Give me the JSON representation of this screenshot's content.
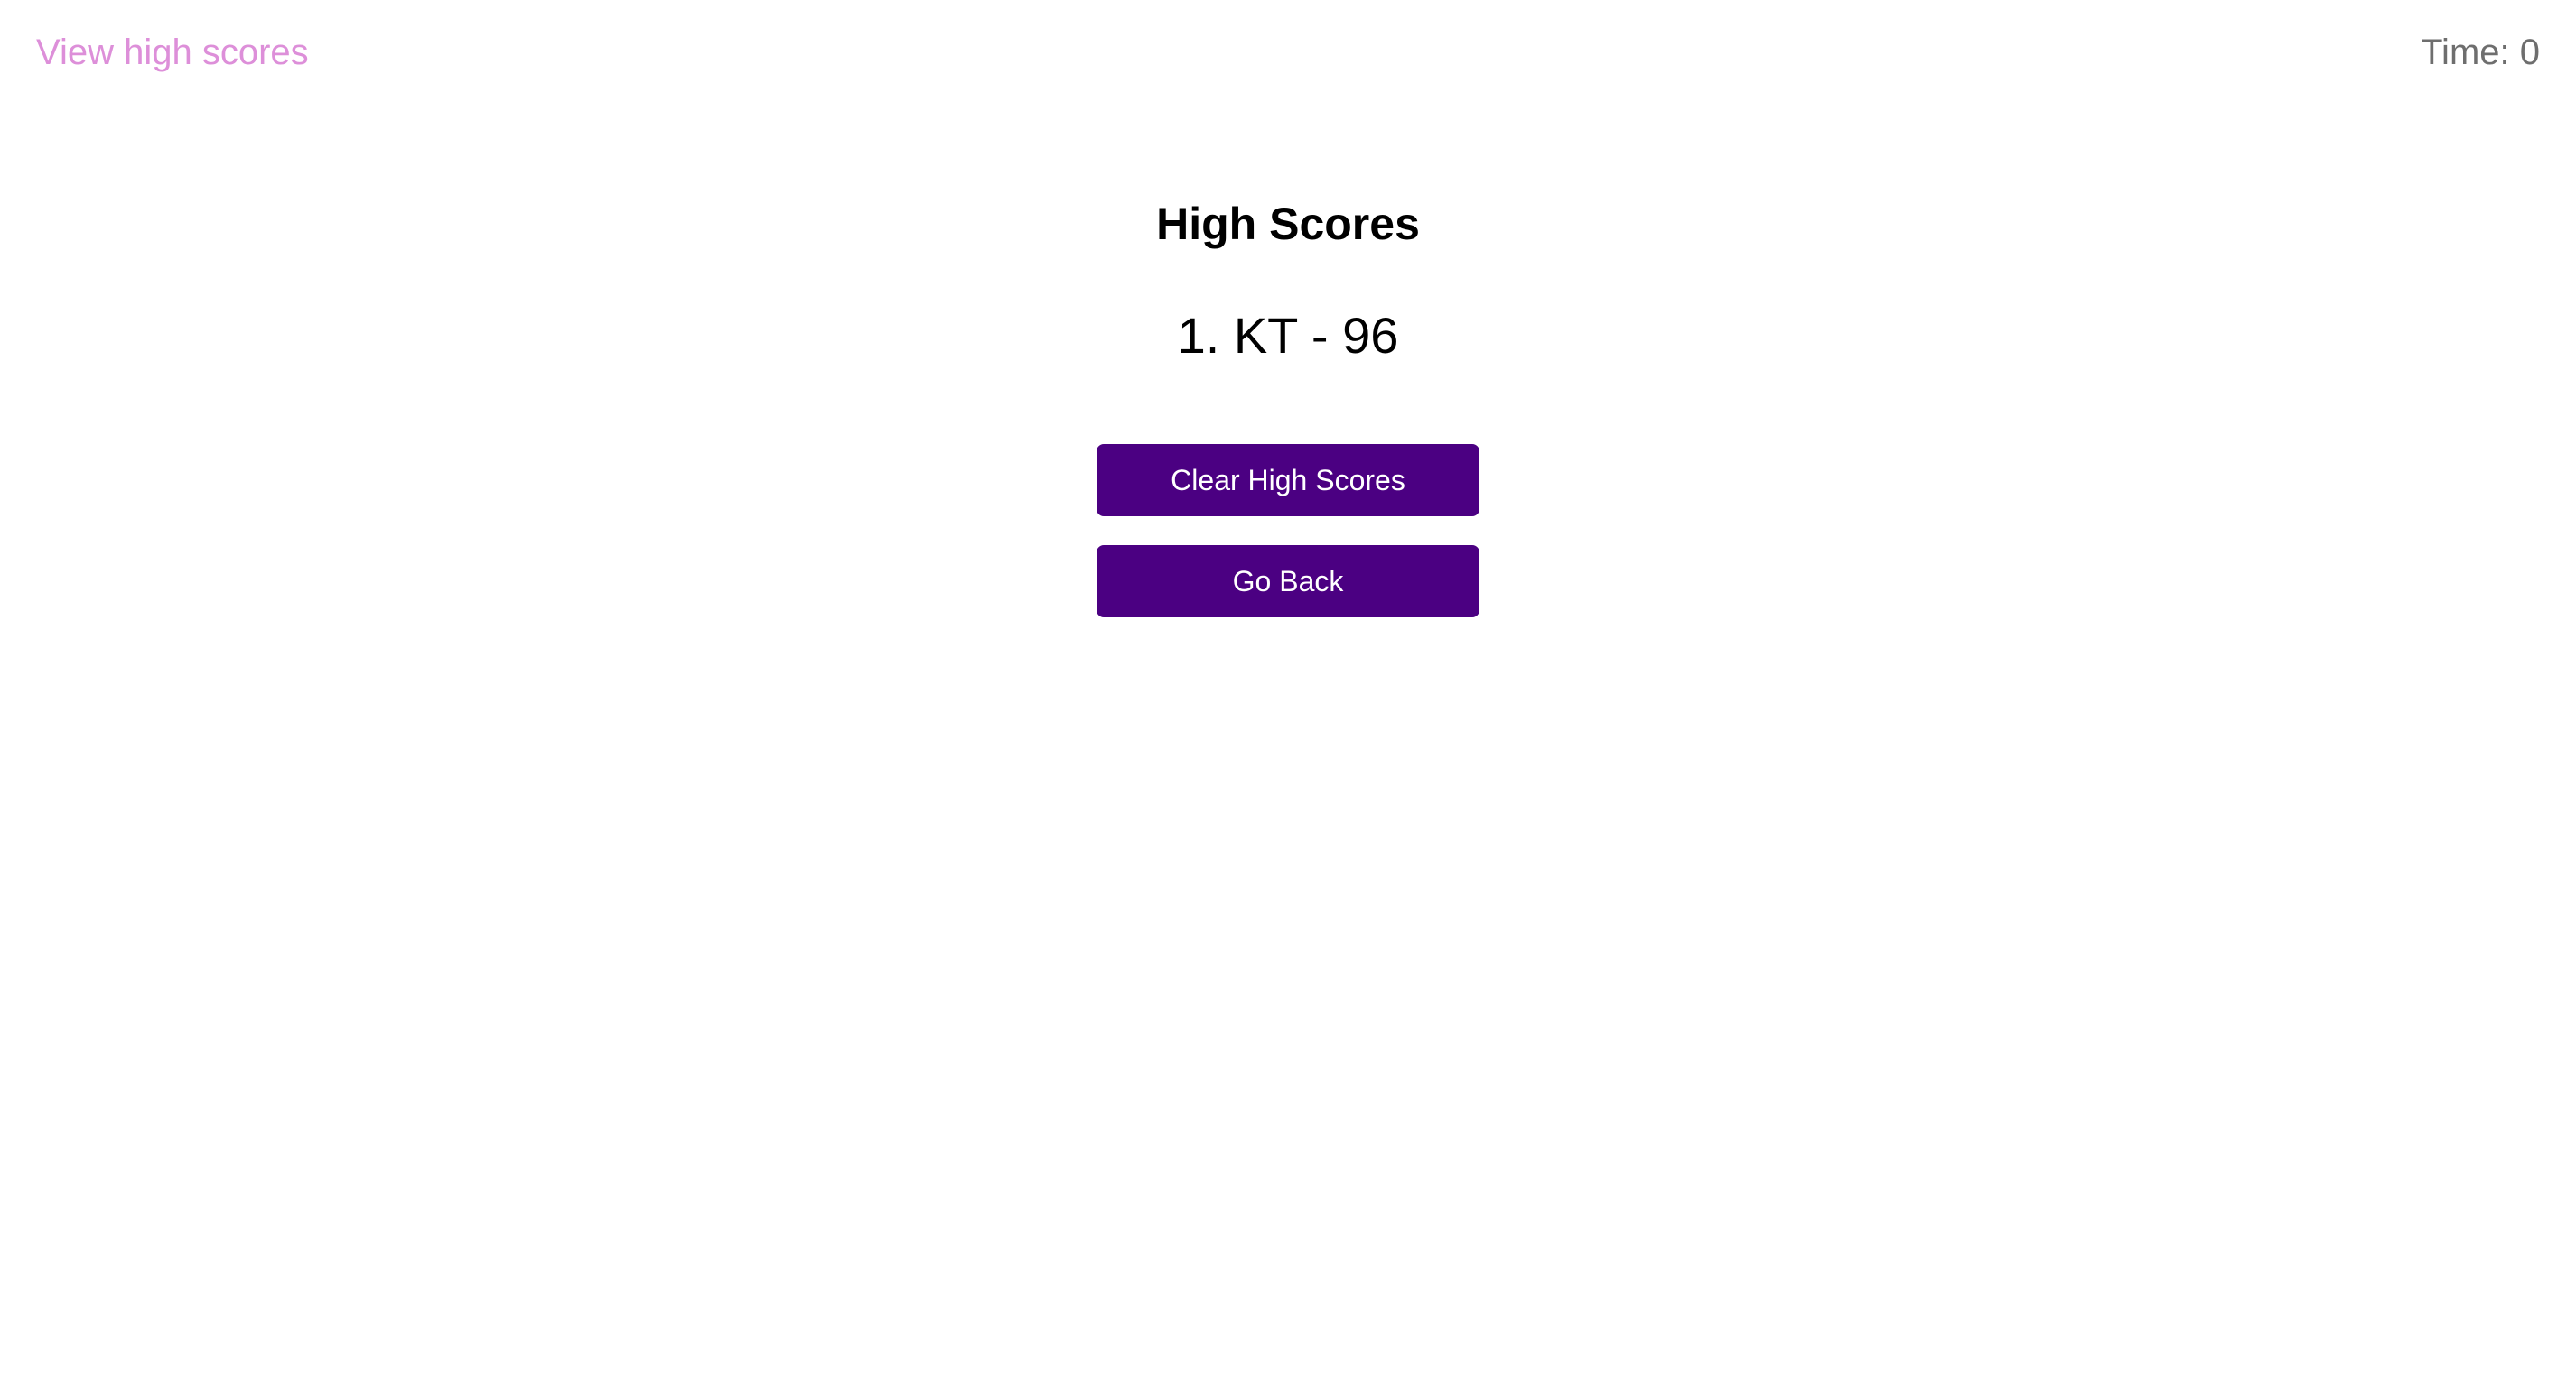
{
  "header": {
    "view_high_scores_link": "View high scores",
    "timer_label": "Time:",
    "timer_value": "0"
  },
  "main": {
    "title": "High Scores",
    "scores": [
      {
        "text": "1. KT - 96"
      }
    ],
    "clear_button_label": "Clear High Scores",
    "go_back_button_label": "Go Back"
  },
  "colors": {
    "link": "#dd8fd9",
    "timer": "#6e6e6e",
    "button_bg": "#4b0082",
    "button_text": "#ffffff"
  }
}
